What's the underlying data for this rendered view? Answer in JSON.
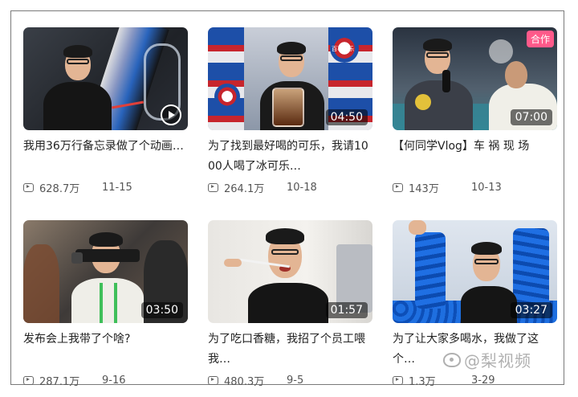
{
  "videos": [
    {
      "title": "我用36万行备忘录做了个动画…",
      "views": "628.7万",
      "date": "11-15",
      "duration": "",
      "badge": ""
    },
    {
      "title": "为了找到最好喝的可乐，我请1000人喝了冰可乐…",
      "views": "264.1万",
      "date": "10-18",
      "duration": "04:50",
      "badge": ""
    },
    {
      "title": "【何同学Vlog】车 祸 现 场",
      "views": "143万",
      "date": "10-13",
      "duration": "07:00",
      "badge": "合作"
    },
    {
      "title": "发布会上我带了个啥?",
      "views": "287.1万",
      "date": "9-16",
      "duration": "03:50",
      "badge": ""
    },
    {
      "title": "为了吃口香糖，我招了个员工喂我…",
      "views": "480.3万",
      "date": "9-5",
      "duration": "01:57",
      "badge": ""
    },
    {
      "title": "为了让大家多喝水，我做了这个…",
      "views": "1.3万",
      "date": "3-29",
      "duration": "03:27",
      "badge": ""
    }
  ],
  "cola_label": "百事可乐",
  "watermark": "@梨视频",
  "colors": {
    "badge": "#ff5a8a",
    "duration_bg": "rgba(0,0,0,0.55)"
  }
}
